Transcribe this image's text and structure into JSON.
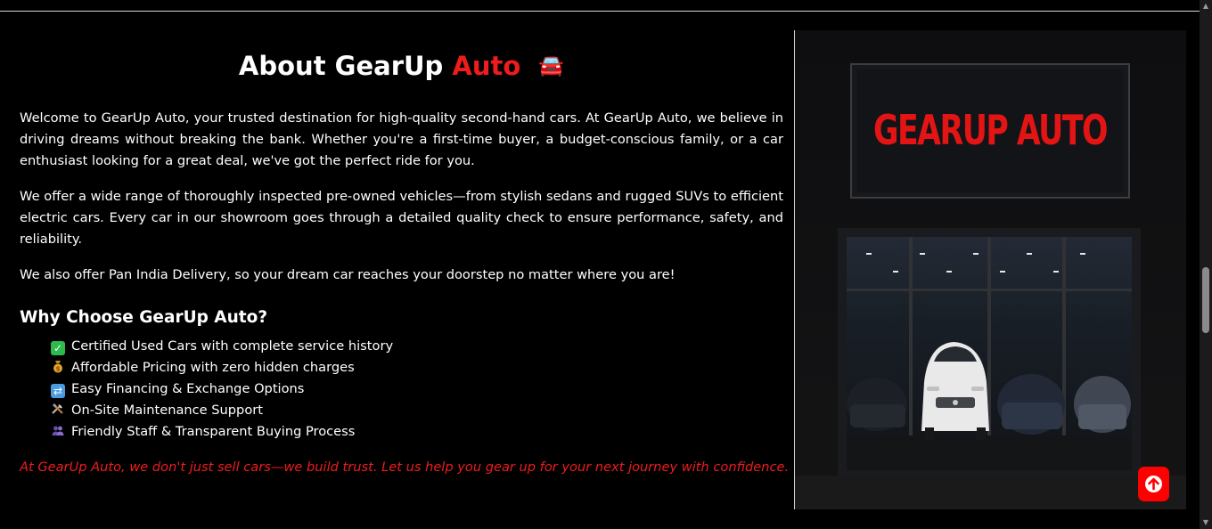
{
  "about": {
    "title_main": "About GearUp",
    "title_accent": "Auto",
    "title_emoji": "🚘",
    "paragraphs": [
      "Welcome to GearUp Auto, your trusted destination for high-quality second-hand cars. At GearUp Auto, we believe in driving dreams without breaking the bank. Whether you're a first-time buyer, a budget-conscious family, or a car enthusiast looking for a great deal, we've got the perfect ride for you.",
      "We offer a wide range of thoroughly inspected pre-owned vehicles—from stylish sedans and rugged SUVs to efficient electric cars. Every car in our showroom goes through a detailed quality check to ensure performance, safety, and reliability.",
      "We also offer Pan India Delivery, so your dream car reaches your doorstep no matter where you are!"
    ],
    "why_heading": "Why Choose GearUp Auto?",
    "features": [
      {
        "icon": "check-mark-icon",
        "text": "Certified Used Cars with complete service history"
      },
      {
        "icon": "money-bag-icon",
        "text": "Affordable Pricing with zero hidden charges"
      },
      {
        "icon": "exchange-arrows-icon",
        "text": "Easy Financing & Exchange Options"
      },
      {
        "icon": "tools-icon",
        "text": "On-Site Maintenance Support"
      },
      {
        "icon": "people-icon",
        "text": "Friendly Staff & Transparent Buying Process"
      }
    ],
    "closing": "At GearUp Auto, we don't just sell cars—we build trust. Let us help you gear up for your next journey with confidence."
  },
  "showroom_image": {
    "sign_text": "GEARUP AUTO"
  },
  "scroll_to_top": {
    "icon": "arrow-up-icon"
  },
  "colors": {
    "accent": "#ee1c1c",
    "background": "#000000",
    "text": "#ffffff"
  }
}
